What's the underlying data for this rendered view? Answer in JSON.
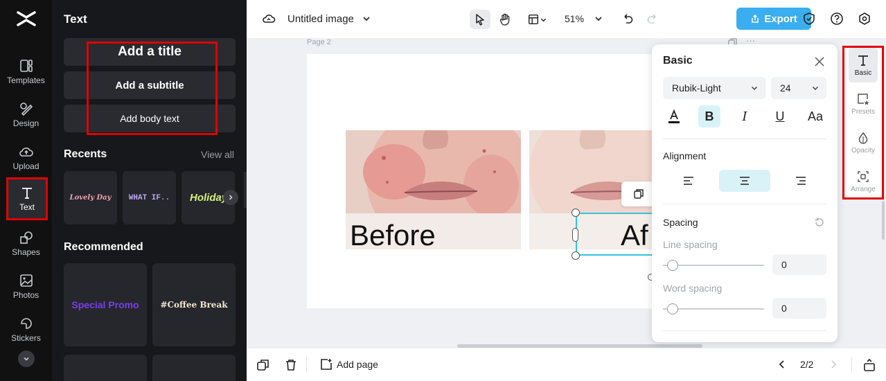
{
  "rail": {
    "items": [
      {
        "label": "Templates"
      },
      {
        "label": "Design"
      },
      {
        "label": "Upload"
      },
      {
        "label": "Text"
      },
      {
        "label": "Shapes"
      },
      {
        "label": "Photos"
      },
      {
        "label": "Stickers"
      }
    ]
  },
  "panel": {
    "title": "Text",
    "add_title": "Add a title",
    "add_subtitle": "Add a subtitle",
    "add_body": "Add body text",
    "recents_title": "Recents",
    "view_all": "View all",
    "recents": [
      "Lovely Day",
      "WHAT IF..",
      "Holiday"
    ],
    "recommended_title": "Recommended",
    "recommended": [
      "Special Promo",
      "#Coffee Break"
    ]
  },
  "topbar": {
    "doc_name": "Untitled image",
    "zoom": "51%",
    "export_label": "Export"
  },
  "canvas": {
    "page_label": "Page 2",
    "caption_before": "Before",
    "caption_after": "Af"
  },
  "props": {
    "title": "Basic",
    "font": "Rubik-Light",
    "size": "24",
    "alignment_label": "Alignment",
    "spacing_label": "Spacing",
    "line_spacing_label": "Line spacing",
    "line_spacing_value": "0",
    "word_spacing_label": "Word spacing",
    "word_spacing_value": "0"
  },
  "tools": [
    "Basic",
    "Presets",
    "Opacity",
    "Arrange"
  ],
  "bottombar": {
    "add_page": "Add page",
    "pager": "2/2"
  },
  "colors": {
    "accent": "#3aaef0",
    "selection": "#34c4d8",
    "highlight": "#e00000",
    "panel_bg": "#17181b"
  }
}
